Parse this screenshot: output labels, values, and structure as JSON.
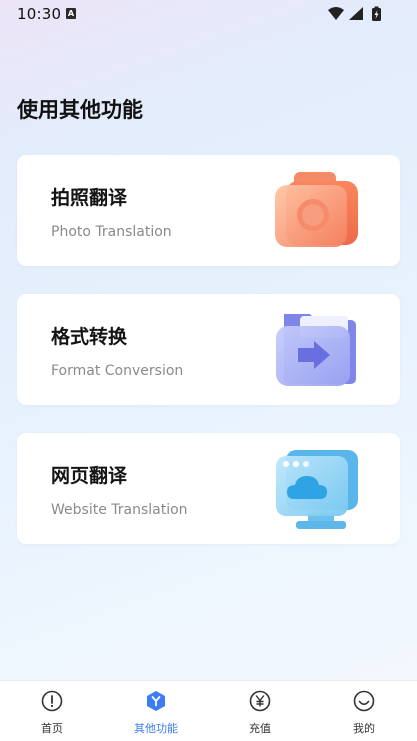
{
  "status_bar": {
    "time": "10:30",
    "notification_glyph": "A",
    "icons": [
      "wifi-icon",
      "cellular-signal-icon",
      "battery-charging-icon"
    ]
  },
  "page": {
    "title": "使用其他功能"
  },
  "features": [
    {
      "title": "拍照翻译",
      "subtitle": "Photo Translation",
      "icon": "camera-icon"
    },
    {
      "title": "格式转换",
      "subtitle": "Format Conversion",
      "icon": "folder-arrow-icon"
    },
    {
      "title": "网页翻译",
      "subtitle": "Website Translation",
      "icon": "cloud-monitor-icon"
    }
  ],
  "tab_bar": {
    "active": "其他功能",
    "tabs": [
      {
        "label": "首页",
        "icon": "home-info-icon"
      },
      {
        "label": "其他功能",
        "icon": "hexagon-y-icon"
      },
      {
        "label": "充值",
        "icon": "yen-coin-icon"
      },
      {
        "label": "我的",
        "icon": "smiley-face-icon"
      }
    ]
  },
  "colors": {
    "accent": "#3c7cf4",
    "camera": "#f79a78",
    "folder": "#8f96ee",
    "cloud": "#6fc3ef"
  }
}
